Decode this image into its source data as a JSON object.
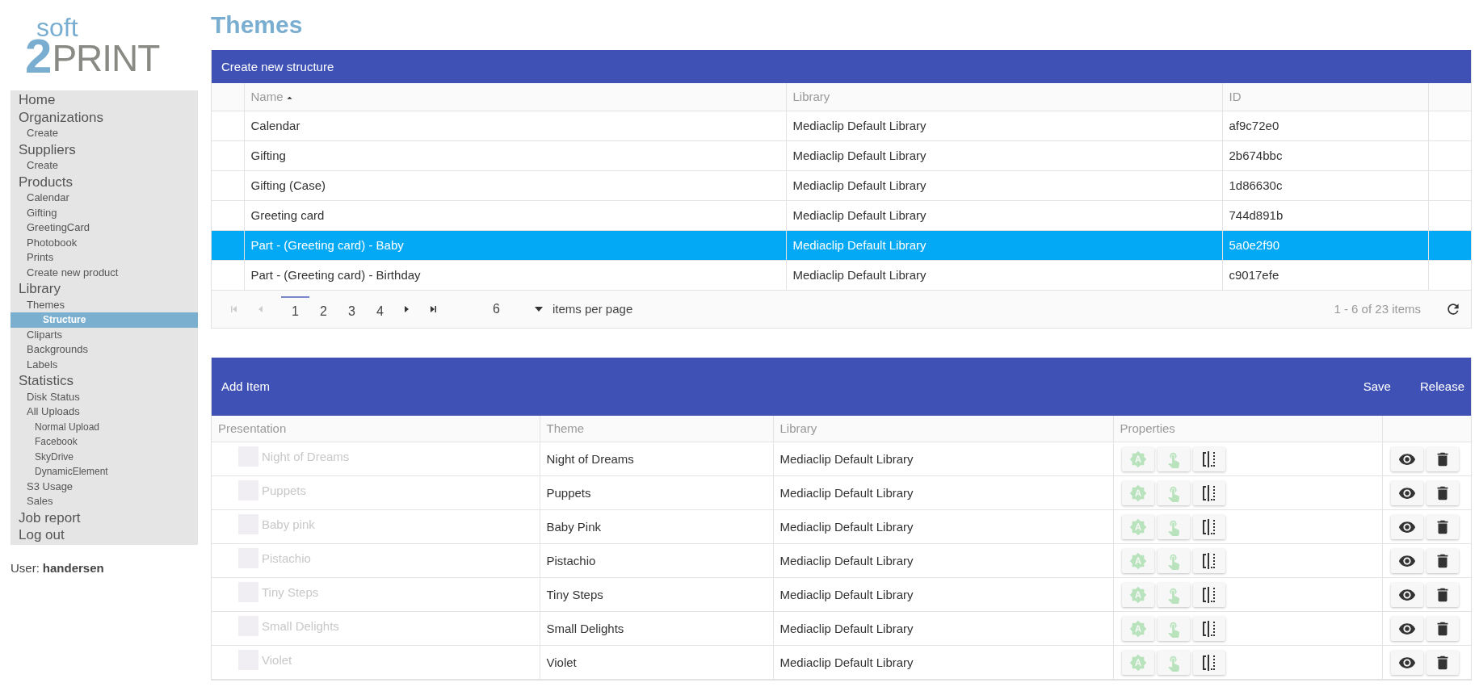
{
  "logo": {
    "top": "soft",
    "mark": "2",
    "bottom": "PRINT"
  },
  "sidebar": {
    "items": [
      {
        "label": "Home",
        "selected": false
      },
      {
        "label": "Organizations",
        "selected": false,
        "children": [
          {
            "label": "Create",
            "selected": false
          }
        ]
      },
      {
        "label": "Suppliers",
        "selected": false,
        "children": [
          {
            "label": "Create",
            "selected": false
          }
        ]
      },
      {
        "label": "Products",
        "selected": false,
        "children": [
          {
            "label": "Calendar",
            "selected": false
          },
          {
            "label": "Gifting",
            "selected": false
          },
          {
            "label": "GreetingCard",
            "selected": false
          },
          {
            "label": "Photobook",
            "selected": false
          },
          {
            "label": "Prints",
            "selected": false
          },
          {
            "label": "Create new product",
            "selected": false
          }
        ]
      },
      {
        "label": "Library",
        "selected": false,
        "children": [
          {
            "label": "Themes",
            "selected": false,
            "children": [
              {
                "label": "Structure",
                "selected": true
              }
            ]
          },
          {
            "label": "Cliparts",
            "selected": false
          },
          {
            "label": "Backgrounds",
            "selected": false
          },
          {
            "label": "Labels",
            "selected": false
          }
        ]
      },
      {
        "label": "Statistics",
        "selected": false,
        "children": [
          {
            "label": "Disk Status",
            "selected": false
          },
          {
            "label": "All Uploads",
            "selected": false,
            "children": [
              {
                "label": "Normal Upload",
                "selected": false
              },
              {
                "label": "Facebook",
                "selected": false
              },
              {
                "label": "SkyDrive",
                "selected": false
              },
              {
                "label": "DynamicElement",
                "selected": false
              }
            ]
          },
          {
            "label": "S3 Usage",
            "selected": false
          },
          {
            "label": "Sales",
            "selected": false
          }
        ]
      },
      {
        "label": "Job report",
        "selected": false
      },
      {
        "label": "Log out",
        "selected": false
      }
    ]
  },
  "user": {
    "label": "User:",
    "name": "handersen"
  },
  "page_title": "Themes",
  "structures": {
    "toolbar_button": "Create new structure",
    "columns": [
      {
        "label": "Name",
        "sorted": true
      },
      {
        "label": "Library",
        "sorted": false
      },
      {
        "label": "ID",
        "sorted": false
      }
    ],
    "rows": [
      {
        "name": "Calendar",
        "library": "Mediaclip Default Library",
        "id": "af9c72e0",
        "selected": false
      },
      {
        "name": "Gifting",
        "library": "Mediaclip Default Library",
        "id": "2b674bbc",
        "selected": false
      },
      {
        "name": "Gifting (Case)",
        "library": "Mediaclip Default Library",
        "id": "1d86630c",
        "selected": false
      },
      {
        "name": "Greeting card",
        "library": "Mediaclip Default Library",
        "id": "744d891b",
        "selected": false
      },
      {
        "name": "Part - (Greeting card) - Baby",
        "library": "Mediaclip Default Library",
        "id": "5a0e2f90",
        "selected": true
      },
      {
        "name": "Part - (Greeting card) - Birthday",
        "library": "Mediaclip Default Library",
        "id": "c9017efe",
        "selected": false
      }
    ],
    "pager": {
      "pages": [
        {
          "label": "1",
          "selected": true
        },
        {
          "label": "2",
          "selected": false
        },
        {
          "label": "3",
          "selected": false
        },
        {
          "label": "4",
          "selected": false
        }
      ],
      "page_size": "6",
      "page_size_label": "items per page",
      "summary": "1 - 6 of 23 items"
    }
  },
  "items": {
    "toolbar_buttons": [
      "Add Item",
      "Save",
      "Release"
    ],
    "columns": [
      "Presentation",
      "Theme",
      "Library",
      "Properties"
    ],
    "rows": [
      {
        "presentation": "Night of Dreams",
        "theme": "Night of Dreams",
        "library": "Mediaclip Default Library",
        "disabled": true
      },
      {
        "presentation": "Puppets",
        "theme": "Puppets",
        "library": "Mediaclip Default Library",
        "disabled": true
      },
      {
        "presentation": "Baby pink",
        "theme": "Baby Pink",
        "library": "Mediaclip Default Library",
        "disabled": true
      },
      {
        "presentation": "Pistachio",
        "theme": "Pistachio",
        "library": "Mediaclip Default Library",
        "disabled": true
      },
      {
        "presentation": "Tiny Steps",
        "theme": "Tiny Steps",
        "library": "Mediaclip Default Library",
        "disabled": true
      },
      {
        "presentation": "Small Delights",
        "theme": "Small Delights",
        "library": "Mediaclip Default Library",
        "disabled": true
      },
      {
        "presentation": "Violet",
        "theme": "Violet",
        "library": "Mediaclip Default Library",
        "disabled": true
      }
    ]
  }
}
